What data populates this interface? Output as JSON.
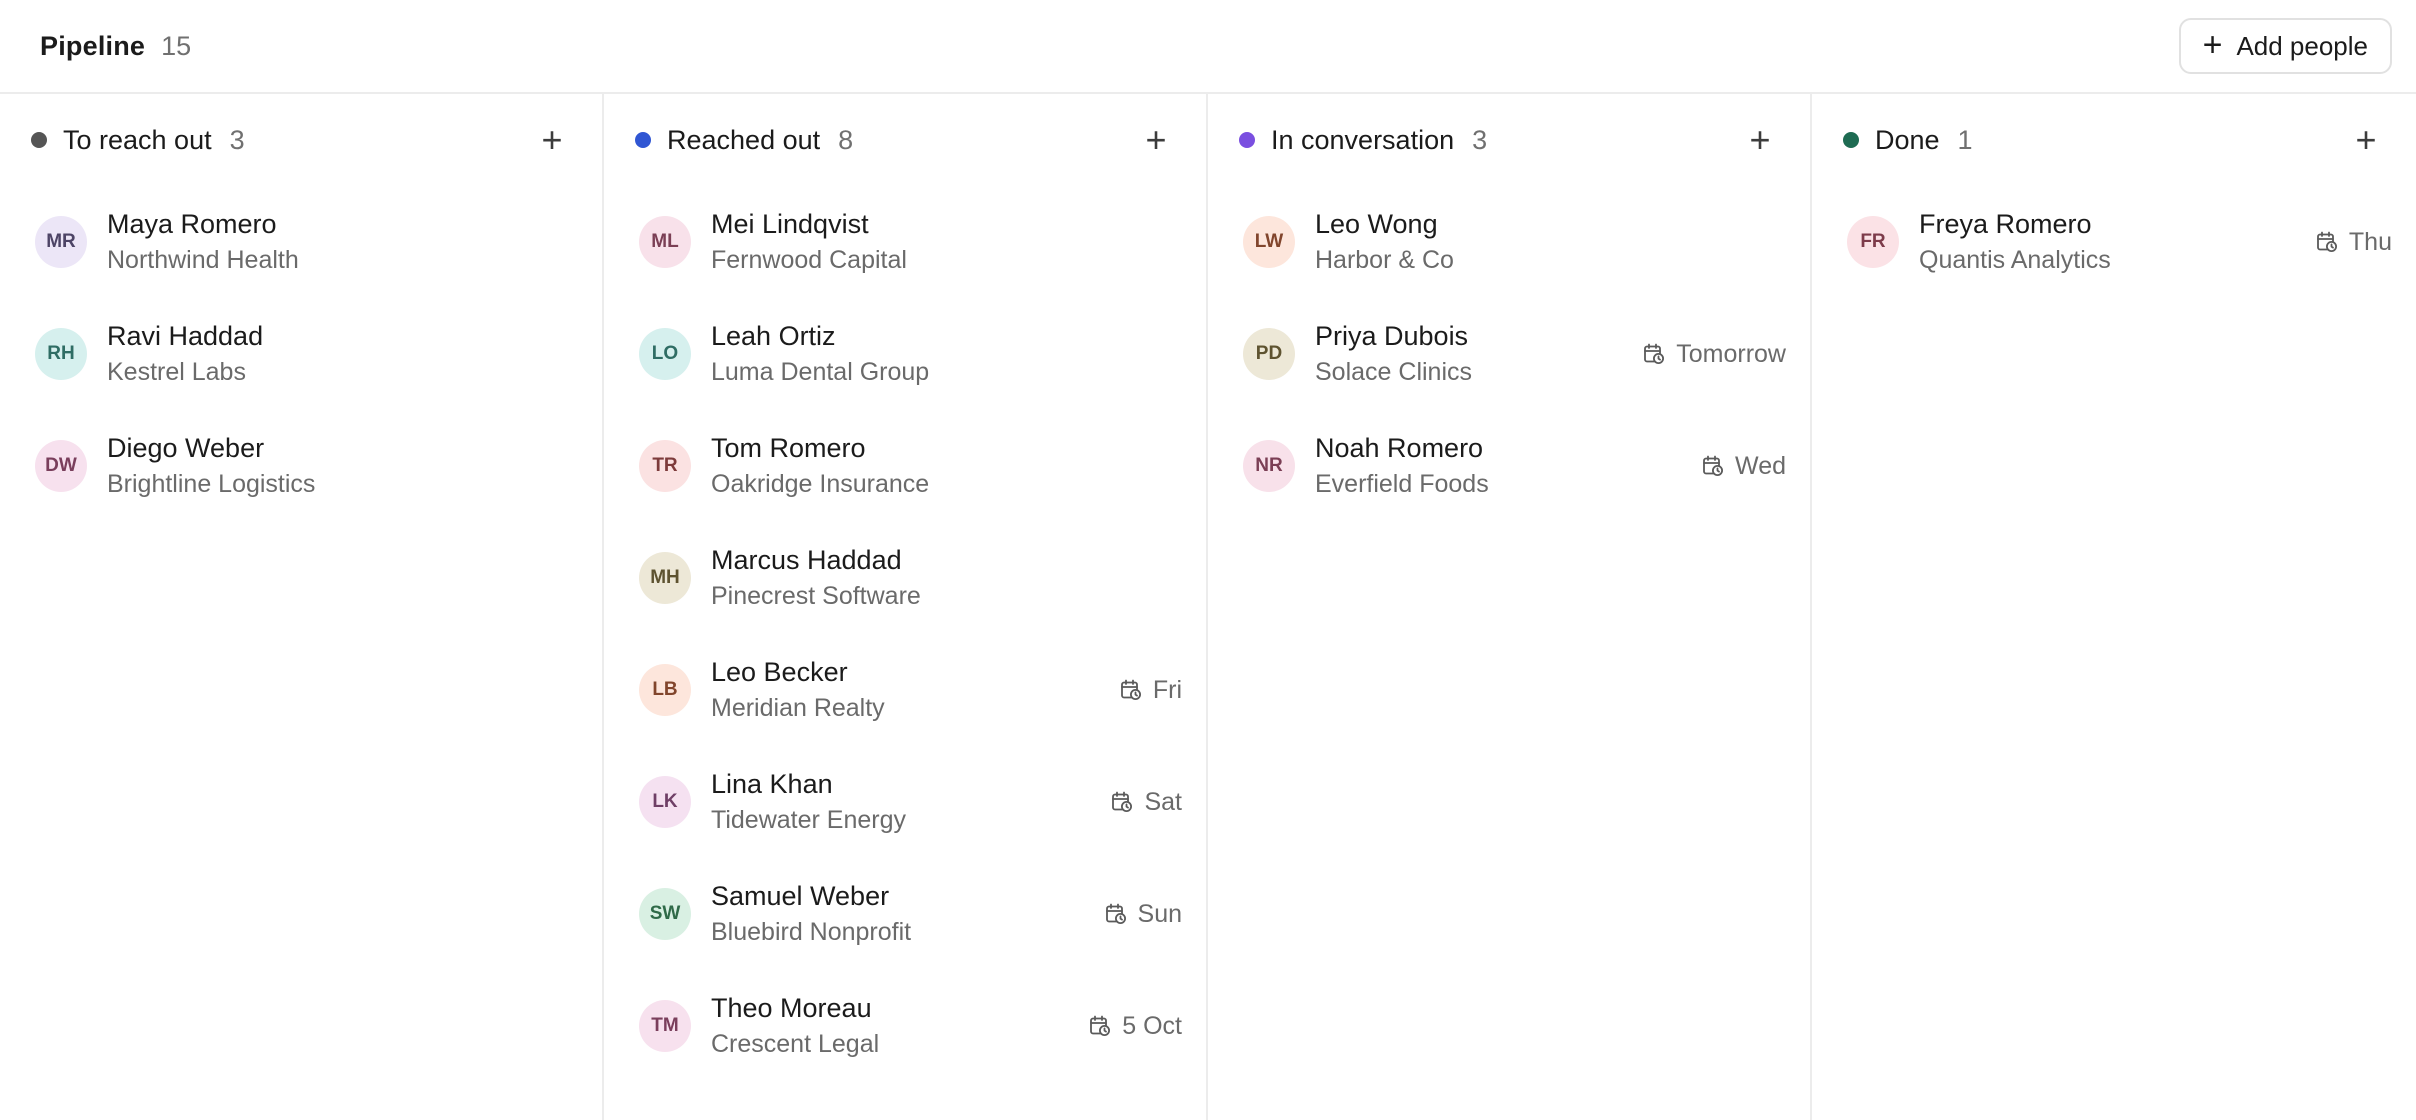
{
  "header": {
    "title": "Pipeline",
    "count": "15",
    "add_people_label": "Add people"
  },
  "columns": [
    {
      "name": "To reach out",
      "count": "3",
      "dot_color": "#555555",
      "cards": [
        {
          "initials": "MR",
          "name": "Maya Romero",
          "company": "Northwind Health",
          "due": "",
          "avatar_bg": "#ece6f7",
          "avatar_fg": "#4d4466"
        },
        {
          "initials": "RH",
          "name": "Ravi Haddad",
          "company": "Kestrel Labs",
          "due": "",
          "avatar_bg": "#d6f0ee",
          "avatar_fg": "#2f6d64"
        },
        {
          "initials": "DW",
          "name": "Diego Weber",
          "company": "Brightline Logistics",
          "due": "",
          "avatar_bg": "#f7e1ee",
          "avatar_fg": "#7a3f5c"
        }
      ]
    },
    {
      "name": "Reached out",
      "count": "8",
      "dot_color": "#3056d3",
      "cards": [
        {
          "initials": "ML",
          "name": "Mei Lindqvist",
          "company": "Fernwood Capital",
          "due": "",
          "avatar_bg": "#f8e1ea",
          "avatar_fg": "#7b3f55"
        },
        {
          "initials": "LO",
          "name": "Leah Ortiz",
          "company": "Luma Dental Group",
          "due": "",
          "avatar_bg": "#d6f0ee",
          "avatar_fg": "#2f6d64"
        },
        {
          "initials": "TR",
          "name": "Tom Romero",
          "company": "Oakridge Insurance",
          "due": "",
          "avatar_bg": "#fbe2e2",
          "avatar_fg": "#7d3b3b"
        },
        {
          "initials": "MH",
          "name": "Marcus Haddad",
          "company": "Pinecrest Software",
          "due": "",
          "avatar_bg": "#ede8d7",
          "avatar_fg": "#5e5330"
        },
        {
          "initials": "LB",
          "name": "Leo Becker",
          "company": "Meridian Realty",
          "due": "Fri",
          "avatar_bg": "#fde6dc",
          "avatar_fg": "#81452c"
        },
        {
          "initials": "LK",
          "name": "Lina Khan",
          "company": "Tidewater Energy",
          "due": "Sat",
          "avatar_bg": "#f5e1f1",
          "avatar_fg": "#6f3f66"
        },
        {
          "initials": "SW",
          "name": "Samuel Weber",
          "company": "Bluebird Nonprofit",
          "due": "Sun",
          "avatar_bg": "#d9f0e3",
          "avatar_fg": "#2f6a48"
        },
        {
          "initials": "TM",
          "name": "Theo Moreau",
          "company": "Crescent Legal",
          "due": "5 Oct",
          "avatar_bg": "#f7e1ee",
          "avatar_fg": "#7a3f5c"
        }
      ]
    },
    {
      "name": "In conversation",
      "count": "3",
      "dot_color": "#7a4fe0",
      "cards": [
        {
          "initials": "LW",
          "name": "Leo Wong",
          "company": "Harbor & Co",
          "due": "",
          "avatar_bg": "#fde6dc",
          "avatar_fg": "#81452c"
        },
        {
          "initials": "PD",
          "name": "Priya Dubois",
          "company": "Solace Clinics",
          "due": "Tomorrow",
          "avatar_bg": "#ede8d7",
          "avatar_fg": "#5e5330"
        },
        {
          "initials": "NR",
          "name": "Noah Romero",
          "company": "Everfield Foods",
          "due": "Wed",
          "avatar_bg": "#f8e1ea",
          "avatar_fg": "#7b3f55"
        }
      ]
    },
    {
      "name": "Done",
      "count": "1",
      "dot_color": "#1e6b52",
      "cards": [
        {
          "initials": "FR",
          "name": "Freya Romero",
          "company": "Quantis Analytics",
          "due": "Thu",
          "avatar_bg": "#fbe2e6",
          "avatar_fg": "#7d3b4a"
        }
      ]
    }
  ]
}
